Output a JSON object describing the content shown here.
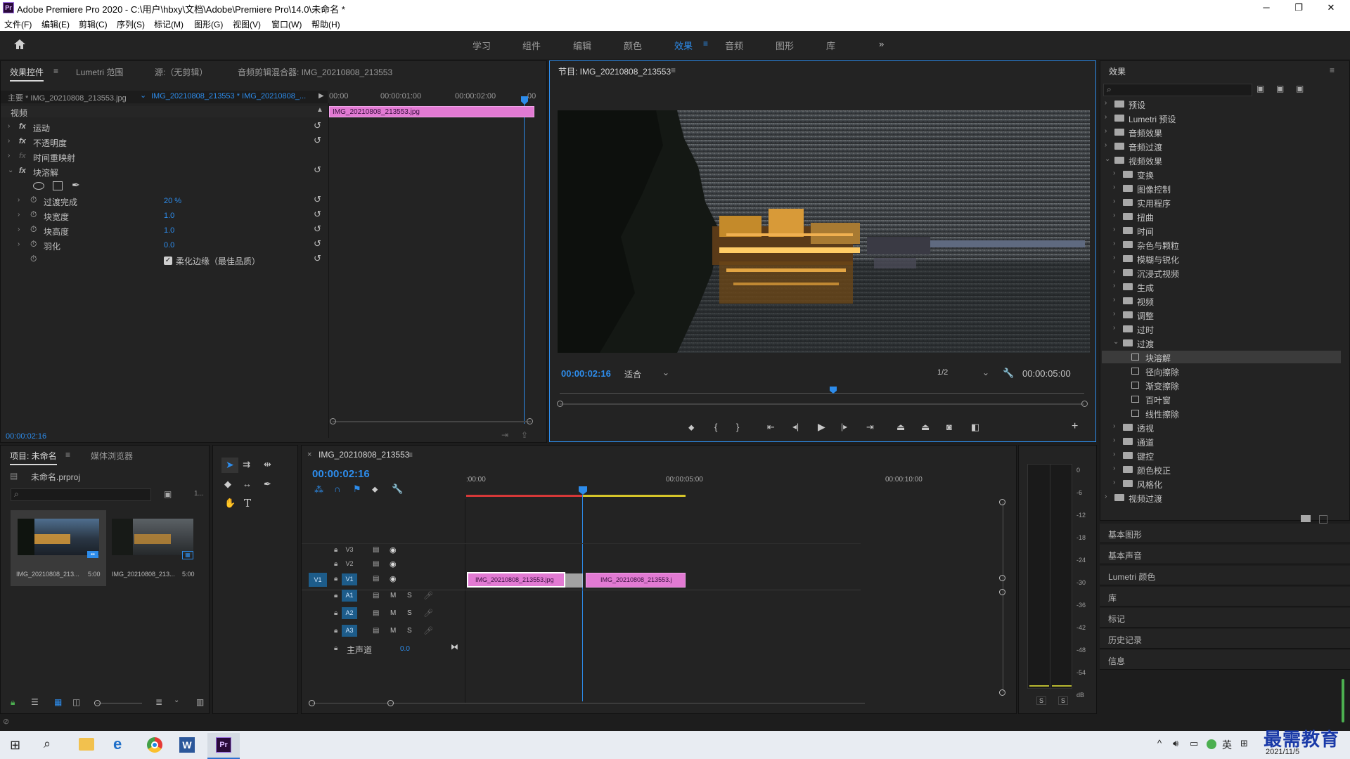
{
  "window": {
    "title": "Adobe Premiere Pro 2020 - C:\\用户\\hbxy\\文档\\Adobe\\Premiere Pro\\14.0\\未命名 *",
    "app_icon": "Pr",
    "min_symbol": "─",
    "max_symbol": "❐",
    "close_symbol": "✕"
  },
  "menu": [
    "文件(F)",
    "编辑(E)",
    "剪辑(C)",
    "序列(S)",
    "标记(M)",
    "图形(G)",
    "视图(V)",
    "窗口(W)",
    "帮助(H)"
  ],
  "workspaces": {
    "items": [
      "学习",
      "组件",
      "编辑",
      "颜色",
      "效果",
      "音频",
      "图形",
      "库"
    ],
    "active": "效果",
    "more": "»"
  },
  "effect_controls": {
    "tabs": [
      "效果控件",
      "Lumetri 范围",
      "源:（无剪辑）",
      "音频剪辑混合器: IMG_20210808_213553"
    ],
    "master_label": "主要 * IMG_20210808_213553.jpg",
    "sequence_label": "IMG_20210808_213553 * IMG_20210808_...",
    "ruler": [
      "00:00",
      "00:00:01:00",
      "00:00:02:00",
      "00"
    ],
    "clip_name": "IMG_20210808_213553.jpg",
    "section": "视频",
    "effects": [
      "运动",
      "不透明度",
      "时间重映射",
      "块溶解"
    ],
    "params": [
      {
        "name": "过渡完成",
        "value": "20 %"
      },
      {
        "name": "块宽度",
        "value": "1.0"
      },
      {
        "name": "块高度",
        "value": "1.0"
      },
      {
        "name": "羽化",
        "value": "0.0"
      }
    ],
    "soft_edge_label": "柔化边缘（最佳品质）",
    "timecode": "00:00:02:16"
  },
  "program_monitor": {
    "title": "节目: IMG_20210808_213553",
    "timecode": "00:00:02:16",
    "fit": "适合",
    "resolution": "1/2",
    "duration": "00:00:05:00"
  },
  "effects_panel": {
    "title": "效果",
    "top_folders": [
      "预设",
      "Lumetri 预设",
      "音频效果",
      "音频过渡",
      "视频效果"
    ],
    "video_effect_folders_a": [
      "变换",
      "图像控制",
      "实用程序",
      "扭曲",
      "时间",
      "杂色与颗粒",
      "模糊与锐化",
      "沉浸式视频",
      "生成",
      "视频",
      "调整",
      "过时",
      "过渡"
    ],
    "transition_items": [
      "块溶解",
      "径向擦除",
      "渐变擦除",
      "百叶窗",
      "线性擦除"
    ],
    "video_effect_folders_b": [
      "透视",
      "通道",
      "键控",
      "颜色校正",
      "风格化"
    ],
    "last_folder": "视频过渡",
    "collapsed_panels": [
      "基本图形",
      "基本声音",
      "Lumetri 颜色",
      "库",
      "标记",
      "历史记录",
      "信息"
    ]
  },
  "project_panel": {
    "tabs": [
      "项目: 未命名",
      "媒体浏览器"
    ],
    "project_file": "未命名.prproj",
    "count": "1...",
    "items": [
      {
        "name": "IMG_20210808_213...",
        "duration": "5:00"
      },
      {
        "name": "IMG_20210808_213...",
        "duration": "5:00"
      }
    ]
  },
  "timeline": {
    "title": "IMG_20210808_213553",
    "timecode": "00:00:02:16",
    "ruler": [
      ":00:00",
      "00:00:05:00",
      "00:00:10:00"
    ],
    "video_tracks": [
      "V3",
      "V2",
      "V1"
    ],
    "audio_tracks": [
      "A1",
      "A2",
      "A3"
    ],
    "source_patch": "V1",
    "master_label": "主声道",
    "master_value": "0.0",
    "mute_label": "M",
    "solo_label": "S",
    "clips": [
      "IMG_20210808_213553.jpg",
      "IMG_20210808_213553.j"
    ]
  },
  "audio_meter": {
    "ticks": [
      "0",
      "-6",
      "-12",
      "-18",
      "-24",
      "-30",
      "-36",
      "-42",
      "-48",
      "-54",
      "dB"
    ],
    "solo_labels": [
      "S",
      "S"
    ]
  },
  "taskbar": {
    "ime": "英",
    "date": "2021/11/5",
    "watermark": "最需教育"
  },
  "colors": {
    "accent": "#2d8ceb",
    "clip_pink": "#e27ad3",
    "panel_bg": "#232323",
    "timeline_red": "#d63838",
    "timeline_yellow": "#d6c52a"
  }
}
